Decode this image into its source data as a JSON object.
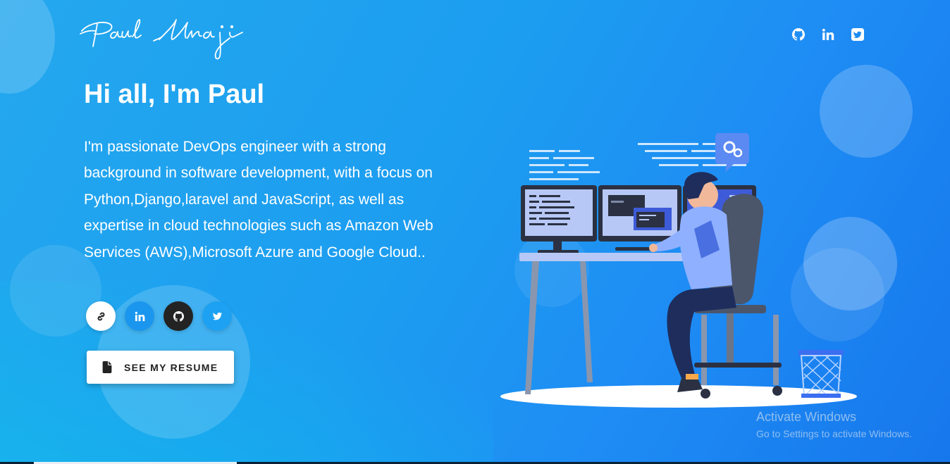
{
  "header": {
    "logo_text": "Paul Unaji",
    "social": [
      {
        "icon": "github-icon",
        "label": "GitHub"
      },
      {
        "icon": "linkedin-icon",
        "label": "LinkedIn"
      },
      {
        "icon": "twitter-icon",
        "label": "Twitter"
      }
    ]
  },
  "hero": {
    "greeting": "Hi all, I'm Paul",
    "intro": "I'm passionate DevOps engineer with a strong background in software development, with a focus on Python,Django,laravel and JavaScript, as well as expertise in cloud technologies such as Amazon Web Services (AWS),Microsoft Azure and Google Cloud..",
    "links": [
      {
        "icon": "link-icon"
      },
      {
        "icon": "linkedin-icon"
      },
      {
        "icon": "github-icon"
      },
      {
        "icon": "twitter-icon"
      }
    ],
    "resume_button": "SEE MY RESUME"
  },
  "watermark": {
    "title": "Activate Windows",
    "subtitle": "Go to Settings to activate Windows."
  },
  "colors": {
    "background_start": "#24a8ee",
    "background_end": "#1677ec",
    "text": "#ffffff",
    "github_circle": "#232323",
    "linkedin_circle": "#1b96ee",
    "twitter_circle": "#1da1f2"
  }
}
